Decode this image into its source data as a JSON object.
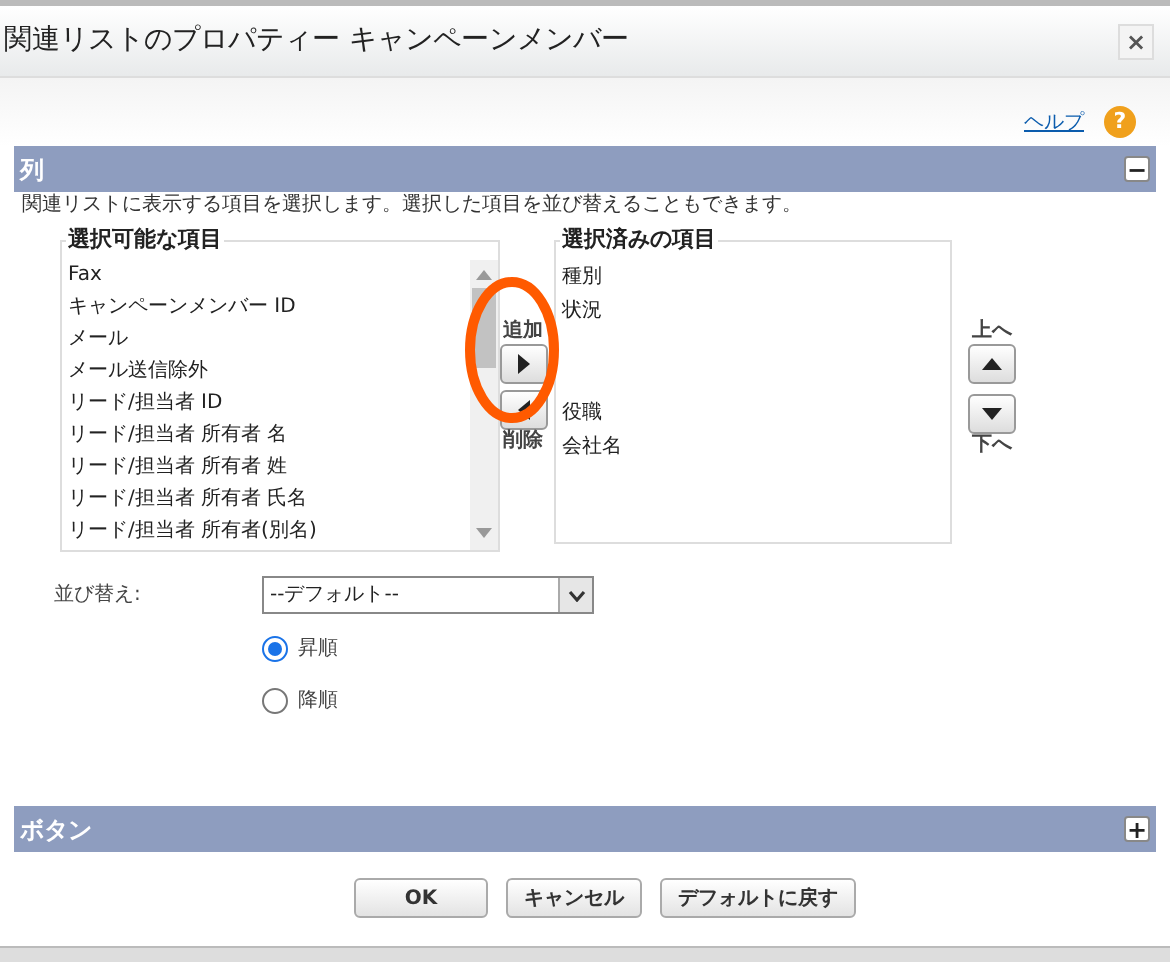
{
  "window": {
    "title": "関連リストのプロパティー キャンペーンメンバー",
    "close": "×"
  },
  "help": {
    "label": "ヘルプ",
    "icon": "?"
  },
  "columns_section": {
    "title": "列",
    "toggle": "−",
    "description": "関連リストに表示する項目を選択します。選択した項目を並び替えることもできます。",
    "available": {
      "title": "選択可能な項目",
      "items": [
        "Fax",
        "キャンペーンメンバー ID",
        "メール",
        "メール送信除外",
        "リード/担当者 ID",
        "リード/担当者 所有者 名",
        "リード/担当者 所有者 姓",
        "リード/担当者 所有者 氏名",
        "リード/担当者 所有者(別名)"
      ]
    },
    "add_label": "追加",
    "remove_label": "削除",
    "selected": {
      "title": "選択済みの項目",
      "items": [
        {
          "label": "種別",
          "covered": false
        },
        {
          "label": "状況",
          "covered": false
        },
        {
          "covered": true
        },
        {
          "covered": true
        },
        {
          "label": "役職",
          "covered": false
        },
        {
          "label": "会社名",
          "covered": false
        }
      ]
    },
    "up_label": "上へ",
    "down_label": "下へ",
    "sort": {
      "label": "並び替え:",
      "value": "--デフォルト--"
    },
    "order": [
      {
        "label": "昇順",
        "selected": true
      },
      {
        "label": "降順",
        "selected": false
      }
    ]
  },
  "buttons_section": {
    "title": "ボタン",
    "toggle": "+"
  },
  "buttons": [
    "OK",
    "キャンセル",
    "デフォルトに戻す"
  ]
}
